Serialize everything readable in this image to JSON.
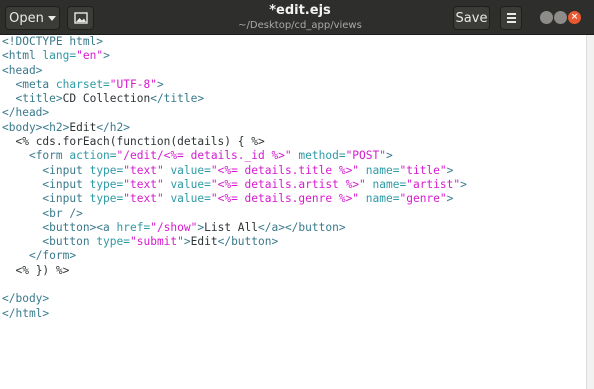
{
  "toolbar": {
    "open_label": "Open",
    "save_label": "Save"
  },
  "window": {
    "title": "*edit.ejs",
    "subtitle": "~/Desktop/cd_app/views"
  },
  "colors": {
    "titlebar": "#2e2e2c",
    "tag": "#3a7a8c",
    "attribute": "#2e9aa5",
    "string": "#d61ad0",
    "text": "#2e3436",
    "close": "#e9582e"
  },
  "icons": [
    "chevron-down-icon",
    "image-icon",
    "hamburger-menu-icon",
    "minimize-icon",
    "maximize-icon",
    "close-icon"
  ],
  "lines": [
    [
      {
        "t": "tag",
        "v": "<!DOCTYPE html>"
      }
    ],
    [
      {
        "t": "tag",
        "v": "<html "
      },
      {
        "t": "attr",
        "v": "lang="
      },
      {
        "t": "str",
        "v": "\"en\""
      },
      {
        "t": "tag",
        "v": ">"
      }
    ],
    [
      {
        "t": "tag",
        "v": "<head>"
      }
    ],
    [
      {
        "t": "tx",
        "v": "  "
      },
      {
        "t": "tag",
        "v": "<meta "
      },
      {
        "t": "attr",
        "v": "charset="
      },
      {
        "t": "str",
        "v": "\"UTF-8\""
      },
      {
        "t": "tag",
        "v": ">"
      }
    ],
    [
      {
        "t": "tx",
        "v": "  "
      },
      {
        "t": "tag",
        "v": "<title>"
      },
      {
        "t": "tx",
        "v": "CD Collection"
      },
      {
        "t": "tag",
        "v": "</title>"
      }
    ],
    [
      {
        "t": "tag",
        "v": "</head>"
      }
    ],
    [
      {
        "t": "tag",
        "v": "<body><h2>"
      },
      {
        "t": "tx",
        "v": "Edit"
      },
      {
        "t": "tag",
        "v": "</h2>"
      }
    ],
    [
      {
        "t": "tx",
        "v": "  "
      },
      {
        "t": "erb",
        "v": "<% cds.forEach(function(details) { %>"
      }
    ],
    [
      {
        "t": "tx",
        "v": "    "
      },
      {
        "t": "tag",
        "v": "<form "
      },
      {
        "t": "attr",
        "v": "action="
      },
      {
        "t": "str",
        "v": "\"/edit/<%= details._id %>\""
      },
      {
        "t": "tx",
        "v": " "
      },
      {
        "t": "attr",
        "v": "method="
      },
      {
        "t": "str",
        "v": "\"POST\""
      },
      {
        "t": "tag",
        "v": ">"
      }
    ],
    [
      {
        "t": "tx",
        "v": "      "
      },
      {
        "t": "tag",
        "v": "<input "
      },
      {
        "t": "attr",
        "v": "type="
      },
      {
        "t": "str",
        "v": "\"text\""
      },
      {
        "t": "tx",
        "v": " "
      },
      {
        "t": "attr",
        "v": "value="
      },
      {
        "t": "str",
        "v": "\"<%= details.title %>\""
      },
      {
        "t": "tx",
        "v": " "
      },
      {
        "t": "attr",
        "v": "name="
      },
      {
        "t": "str",
        "v": "\"title\""
      },
      {
        "t": "tag",
        "v": ">"
      }
    ],
    [
      {
        "t": "tx",
        "v": "      "
      },
      {
        "t": "tag",
        "v": "<input "
      },
      {
        "t": "attr",
        "v": "type="
      },
      {
        "t": "str",
        "v": "\"text\""
      },
      {
        "t": "tx",
        "v": " "
      },
      {
        "t": "attr",
        "v": "value="
      },
      {
        "t": "str",
        "v": "\"<%= details.artist %>\""
      },
      {
        "t": "tx",
        "v": " "
      },
      {
        "t": "attr",
        "v": "name="
      },
      {
        "t": "str",
        "v": "\"artist\""
      },
      {
        "t": "tag",
        "v": ">"
      }
    ],
    [
      {
        "t": "tx",
        "v": "      "
      },
      {
        "t": "tag",
        "v": "<input "
      },
      {
        "t": "attr",
        "v": "type="
      },
      {
        "t": "str",
        "v": "\"text\""
      },
      {
        "t": "tx",
        "v": " "
      },
      {
        "t": "attr",
        "v": "value="
      },
      {
        "t": "str",
        "v": "\"<%= details.genre %>\""
      },
      {
        "t": "tx",
        "v": " "
      },
      {
        "t": "attr",
        "v": "name="
      },
      {
        "t": "str",
        "v": "\"genre\""
      },
      {
        "t": "tag",
        "v": ">"
      }
    ],
    [
      {
        "t": "tx",
        "v": "      "
      },
      {
        "t": "tag",
        "v": "<br />"
      }
    ],
    [
      {
        "t": "tx",
        "v": "      "
      },
      {
        "t": "tag",
        "v": "<button><a "
      },
      {
        "t": "attr",
        "v": "href="
      },
      {
        "t": "str",
        "v": "\"/show\""
      },
      {
        "t": "tag",
        "v": ">"
      },
      {
        "t": "tx",
        "v": "List All"
      },
      {
        "t": "tag",
        "v": "</a></button>"
      }
    ],
    [
      {
        "t": "tx",
        "v": "      "
      },
      {
        "t": "tag",
        "v": "<button "
      },
      {
        "t": "attr",
        "v": "type="
      },
      {
        "t": "str",
        "v": "\"submit\""
      },
      {
        "t": "tag",
        "v": ">"
      },
      {
        "t": "tx",
        "v": "Edit"
      },
      {
        "t": "tag",
        "v": "</button>"
      }
    ],
    [
      {
        "t": "tx",
        "v": "    "
      },
      {
        "t": "tag",
        "v": "</form>"
      }
    ],
    [
      {
        "t": "tx",
        "v": "  "
      },
      {
        "t": "erb",
        "v": "<% }) %>"
      }
    ],
    [],
    [
      {
        "t": "tag",
        "v": "</body>"
      }
    ],
    [
      {
        "t": "tag",
        "v": "</html>"
      }
    ]
  ]
}
